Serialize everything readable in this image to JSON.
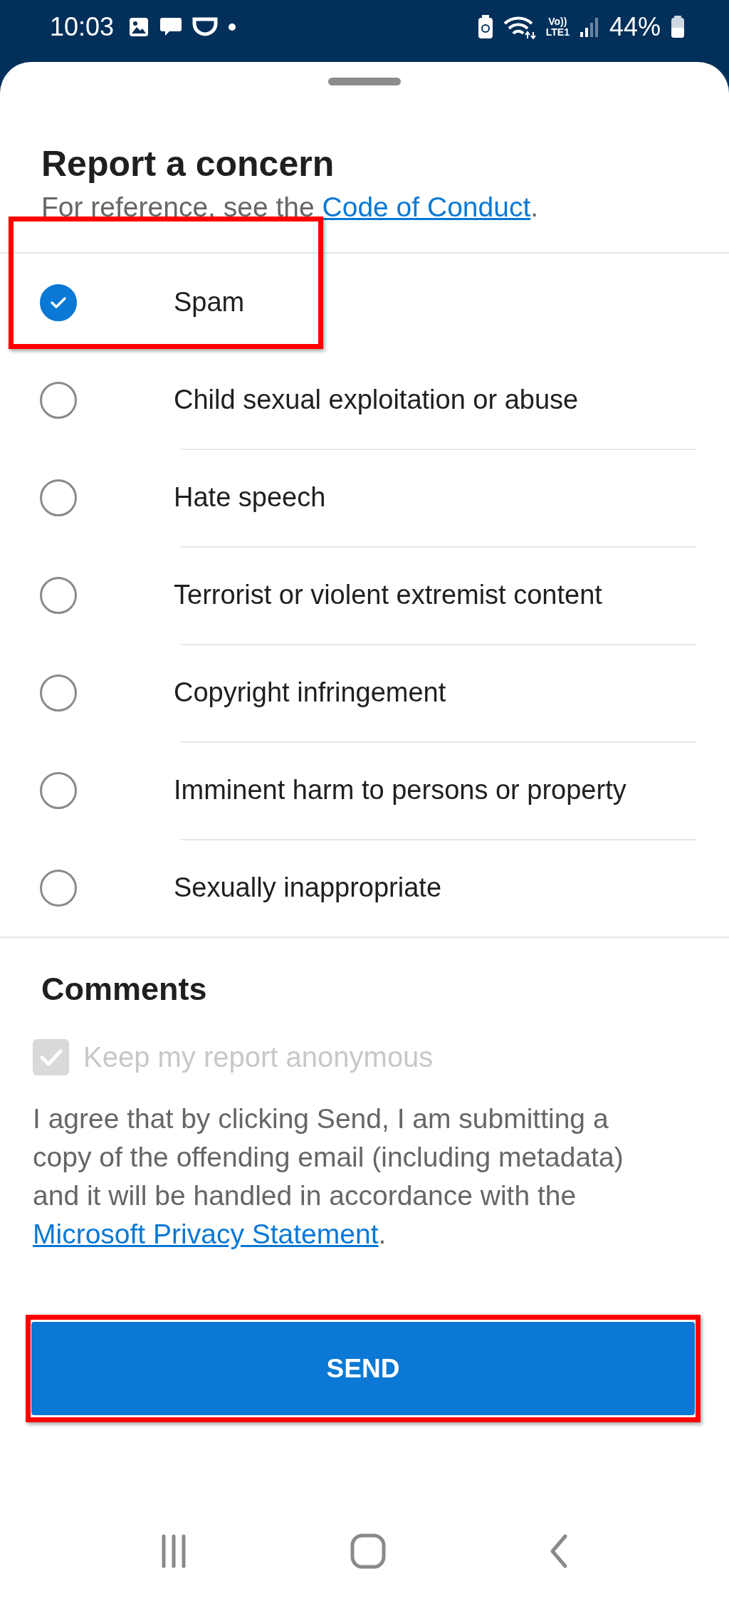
{
  "status_bar": {
    "time": "10:03",
    "volte_label": "Vo))",
    "network_label": "LTE1",
    "battery": "44%"
  },
  "sheet": {
    "title": "Report a concern",
    "subtitle_before": "For reference, see the ",
    "subtitle_link": "Code of Conduct",
    "subtitle_after": "."
  },
  "options": [
    {
      "label": "Spam",
      "selected": true,
      "highlighted": true
    },
    {
      "label": "Child sexual exploitation or abuse",
      "selected": false,
      "highlighted": false
    },
    {
      "label": "Hate speech",
      "selected": false,
      "highlighted": false
    },
    {
      "label": "Terrorist or violent extremist content",
      "selected": false,
      "highlighted": false
    },
    {
      "label": "Copyright infringement",
      "selected": false,
      "highlighted": false
    },
    {
      "label": "Imminent harm to persons or property",
      "selected": false,
      "highlighted": false
    },
    {
      "label": "Sexually inappropriate",
      "selected": false,
      "highlighted": false
    }
  ],
  "comments": {
    "heading": "Comments",
    "anonymous": {
      "label": "Keep my report anonymous",
      "checked": true,
      "disabled": true
    },
    "consent_before": "I agree that by clicking Send, I am submitting a copy of the offending email (including metadata) and it will be handled in accordance with the ",
    "consent_link": "Microsoft Privacy Statement",
    "consent_after": "."
  },
  "send_button": {
    "label": "SEND",
    "highlighted": true
  }
}
